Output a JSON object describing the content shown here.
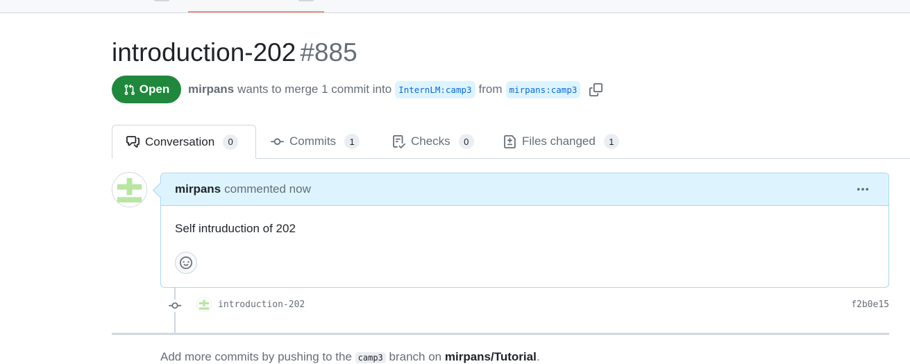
{
  "pr": {
    "title": "introduction-202",
    "number": "#885",
    "state": "Open",
    "author": "mirpans",
    "merge_text": "wants to merge 1 commit into",
    "base_branch": "InternLM:camp3",
    "from_text": "from",
    "head_branch": "mirpans:camp3"
  },
  "tabs": [
    {
      "label": "Conversation",
      "count": "0",
      "icon": "comment-discussion-icon"
    },
    {
      "label": "Commits",
      "count": "1",
      "icon": "git-commit-icon"
    },
    {
      "label": "Checks",
      "count": "0",
      "icon": "checklist-icon"
    },
    {
      "label": "Files changed",
      "count": "1",
      "icon": "file-diff-icon"
    }
  ],
  "comment": {
    "author": "mirpans",
    "action": "commented now",
    "body": "Self intruduction of 202"
  },
  "commit": {
    "message": "introduction-202",
    "sha": "f2b0e15"
  },
  "footer": {
    "pre": "Add more commits by pushing to the",
    "branch": "camp3",
    "mid": "branch on",
    "repo": "mirpans/Tutorial",
    "post": "."
  },
  "colors": {
    "open_green": "#1f883d",
    "accent_blue": "#0969da",
    "comment_header_bg": "#ddf4ff",
    "tab_underline": "#fd8c73"
  }
}
